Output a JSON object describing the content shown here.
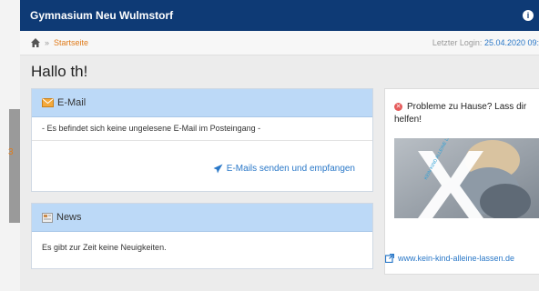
{
  "header": {
    "title": "Gymnasium Neu Wulmstorf",
    "info_icon": "i"
  },
  "breadcrumb": {
    "separator": "»",
    "current": "Startseite"
  },
  "login": {
    "label": "Letzter Login:",
    "date": "25.04.2020 09:"
  },
  "greeting": "Hallo th!",
  "left_edge_marker": "3",
  "mail": {
    "title": "E-Mail",
    "empty_message": "- Es befindet sich keine ungelesene E-Mail im Posteingang -",
    "action_label": "E-Mails senden und empfangen"
  },
  "news": {
    "title": "News",
    "empty_message": "Es gibt zur Zeit keine Neuigkeiten."
  },
  "help_box": {
    "title": "Probleme zu Hause? Lass dir helfen!",
    "link_label": "www.kein-kind-alleine-lassen.de",
    "image_caption": "KEIN KIND ALLEINE LASSEN"
  },
  "colors": {
    "topbar": "#0e3a75",
    "panel_header": "#bcd9f7",
    "link": "#2a78c8",
    "accent_orange": "#e07b1a"
  }
}
